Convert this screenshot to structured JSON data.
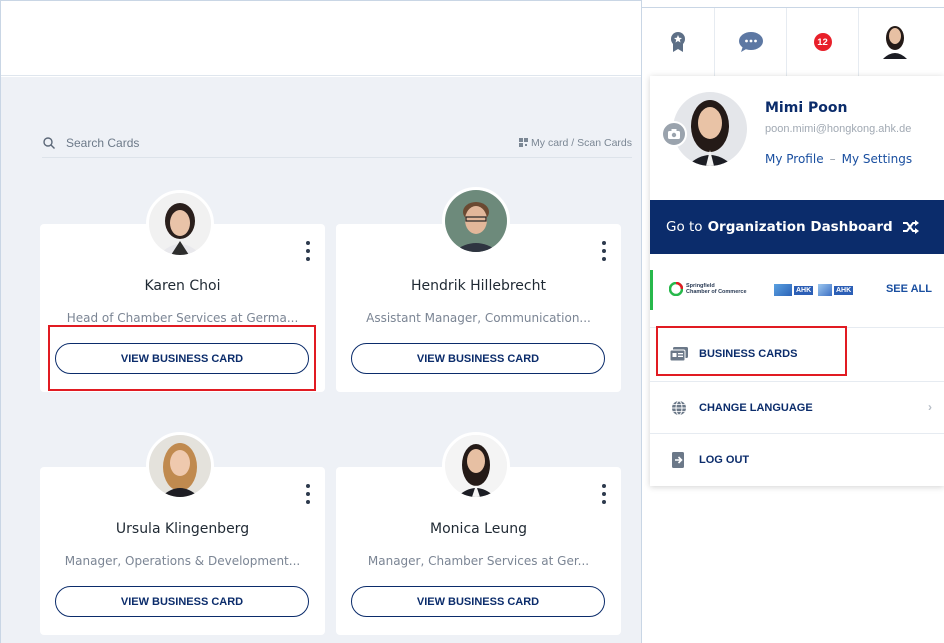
{
  "search": {
    "placeholder": "Search Cards",
    "my_card_scan": "My card / Scan Cards"
  },
  "cards": [
    {
      "name": "Karen Choi",
      "role": "Head of Chamber Services at Germa...",
      "button": "VIEW BUSINESS CARD"
    },
    {
      "name": "Hendrik Hillebrecht",
      "role": "Assistant Manager, Communication...",
      "button": "VIEW BUSINESS CARD"
    },
    {
      "name": "Ursula Klingenberg",
      "role": "Manager, Operations & Development...",
      "button": "VIEW BUSINESS CARD"
    },
    {
      "name": "Monica Leung",
      "role": "Manager, Chamber Services at Ger...",
      "button": "VIEW BUSINESS CARD"
    }
  ],
  "header": {
    "icons": [
      "award-badge-icon",
      "chat-bubble-icon",
      "notifications-badge",
      "user-avatar"
    ],
    "notification_count": "12"
  },
  "profile": {
    "name": "Mimi Poon",
    "email": "poon.mimi@hongkong.ahk.de",
    "my_profile": "My Profile",
    "separator": "–",
    "my_settings": "My Settings"
  },
  "org_dashboard": {
    "prefix": "Go to",
    "bold": "Organization Dashboard"
  },
  "organizations": {
    "logo1_line1": "Springfield",
    "logo1_line2": "Chamber of Commerce",
    "logo2": "AHK",
    "logo3": "AHK",
    "see_all": "SEE ALL"
  },
  "menu": {
    "business_cards": "BUSINESS CARDS",
    "change_language": "CHANGE LANGUAGE",
    "log_out": "LOG OUT"
  },
  "colors": {
    "navy": "#0b2c6b",
    "link_blue": "#1a4fa0",
    "highlight_red": "#e11b22",
    "org_green": "#27b84b",
    "badge_red": "#e8202a"
  }
}
